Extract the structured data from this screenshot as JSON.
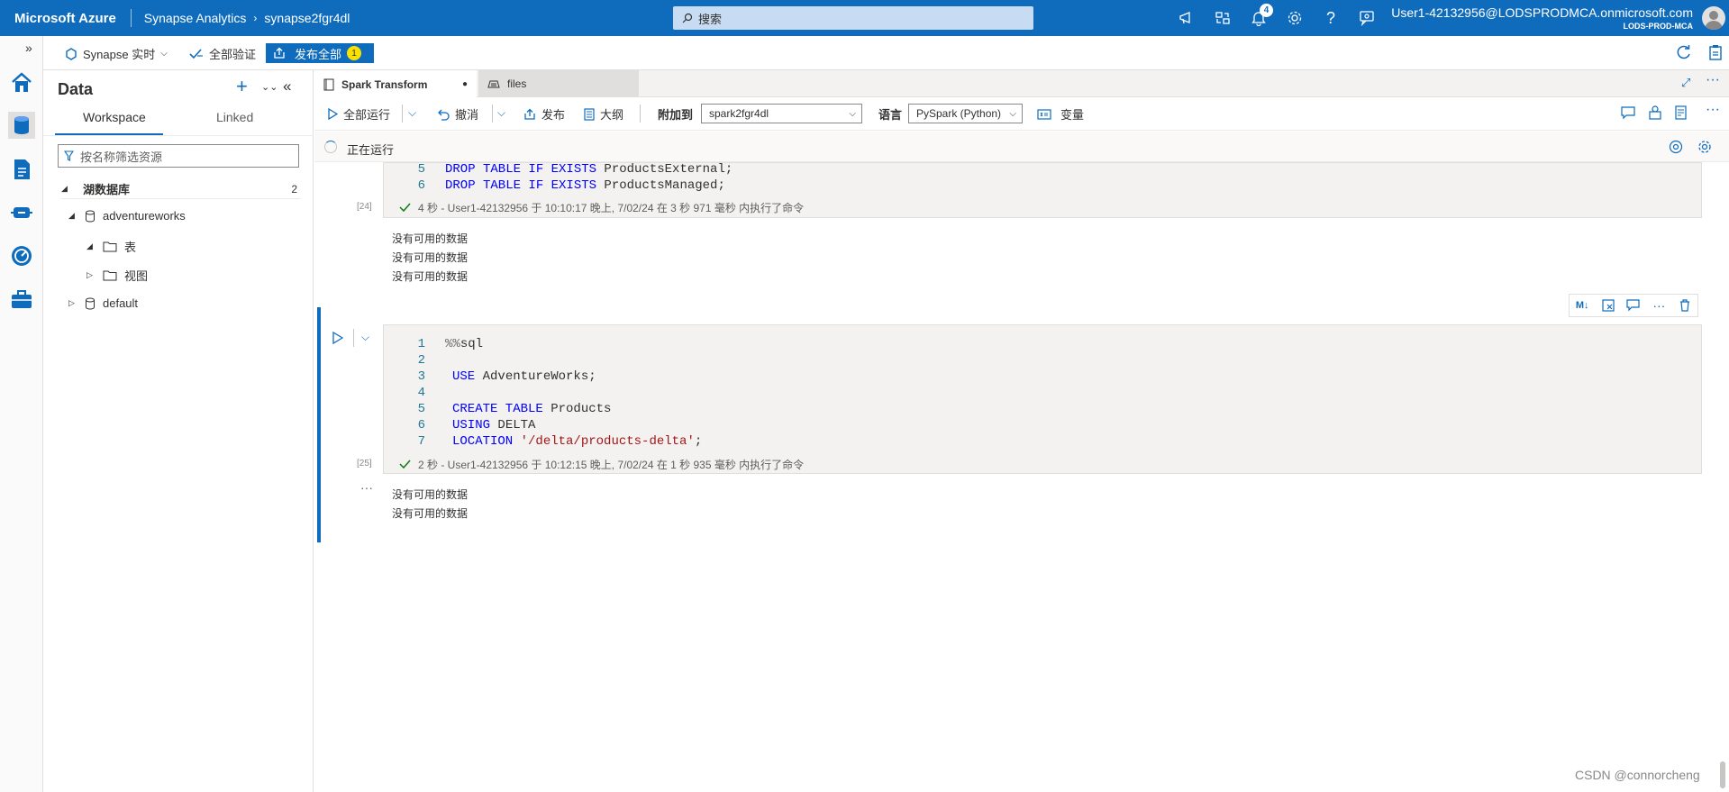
{
  "topbar": {
    "brand": "Microsoft Azure",
    "service": "Synapse Analytics",
    "workspace": "synapse2fgr4dl",
    "search_placeholder": "搜索",
    "notification_count": "4",
    "user_name": "User1-42132956@LODSPRODMCA.onmicrosoft.com",
    "user_tenant": "LODS-PROD-MCA"
  },
  "toolbar2": {
    "mode": "Synapse 实时",
    "validate_all": "全部验证",
    "publish_all": "发布全部",
    "publish_count": "1"
  },
  "data_panel": {
    "title": "Data",
    "tabs": [
      "Workspace",
      "Linked"
    ],
    "filter_placeholder": "按名称筛选资源",
    "section": {
      "label": "湖数据库",
      "count": "2"
    },
    "tree": {
      "db1": "adventureworks",
      "tables": "表",
      "views": "视图",
      "db2": "default"
    }
  },
  "editor": {
    "tabs": [
      {
        "label": "Spark Transform"
      },
      {
        "label": "files"
      }
    ],
    "toolbar": {
      "run_all": "全部运行",
      "undo": "撤消",
      "publish": "发布",
      "outline": "大纲",
      "attach_label": "附加到",
      "attach_value": "spark2fgr4dl",
      "lang_label": "语言",
      "lang_value": "PySpark (Python)",
      "variables": "变量"
    },
    "status": "正在运行",
    "cell1": {
      "lines": [
        {
          "n": "5",
          "kw": "DROP TABLE IF EXISTS",
          "rest": " ProductsExternal;"
        },
        {
          "n": "6",
          "kw": "DROP TABLE IF EXISTS",
          "rest": " ProductsManaged;"
        }
      ],
      "exec_num": "[24]",
      "exec_text": "4 秒 - User1-42132956 于 10:10:17 晚上, 7/02/24 在 3 秒 971 毫秒 内执行了命令",
      "outputs": [
        "没有可用的数据",
        "没有可用的数据",
        "没有可用的数据"
      ]
    },
    "cell2": {
      "line1_magic": "%%",
      "line1_rest": "sql",
      "line3_kw": "USE",
      "line3_rest": " AdventureWorks;",
      "line5_kw": "CREATE TABLE",
      "line5_rest": " Products",
      "line6_kw": "USING",
      "line6_rest": " DELTA",
      "line7_kw": "LOCATION",
      "line7_str": "'/delta/products-delta'",
      "line7_end": ";",
      "line_numbers": [
        "1",
        "2",
        "3",
        "4",
        "5",
        "6",
        "7"
      ],
      "exec_num": "[25]",
      "exec_text": "2 秒 - User1-42132956 于 10:12:15 晚上, 7/02/24 在 1 秒 935 毫秒 内执行了命令",
      "outputs": [
        "没有可用的数据",
        "没有可用的数据"
      ],
      "md_tool": "M↓"
    }
  },
  "watermark": "CSDN @connorcheng"
}
